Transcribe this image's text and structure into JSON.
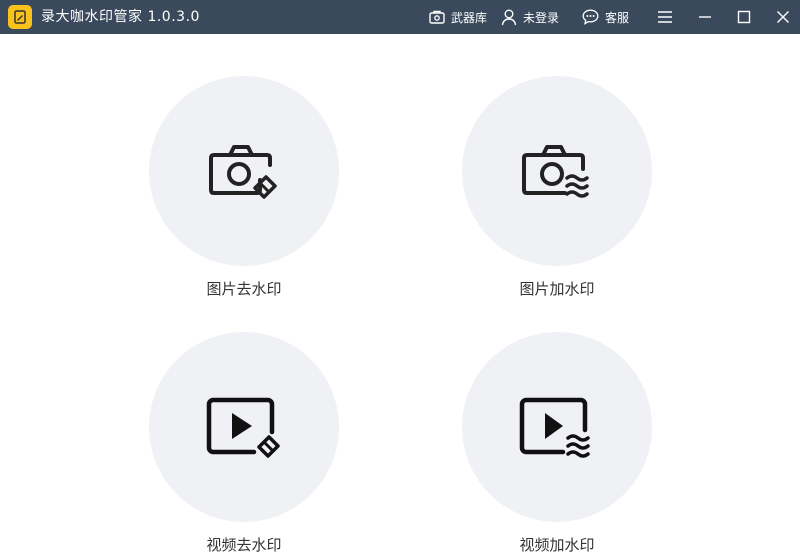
{
  "titlebar": {
    "app_title": "录大咖水印管家  1.0.3.0",
    "arsenal_label": "武器库",
    "login_label": "未登录",
    "service_label": "客服",
    "background": "#3a4a5c",
    "logo_color": "#f9c21a"
  },
  "cards": [
    {
      "label": "图片去水印",
      "icon": "camera-eraser-icon"
    },
    {
      "label": "图片加水印",
      "icon": "camera-watermark-icon"
    },
    {
      "label": "视频去水印",
      "icon": "video-eraser-icon"
    },
    {
      "label": "视频加水印",
      "icon": "video-watermark-icon"
    }
  ],
  "colors": {
    "card_bg": "#eff1f5",
    "icon": "#222222",
    "text": "#333333"
  }
}
